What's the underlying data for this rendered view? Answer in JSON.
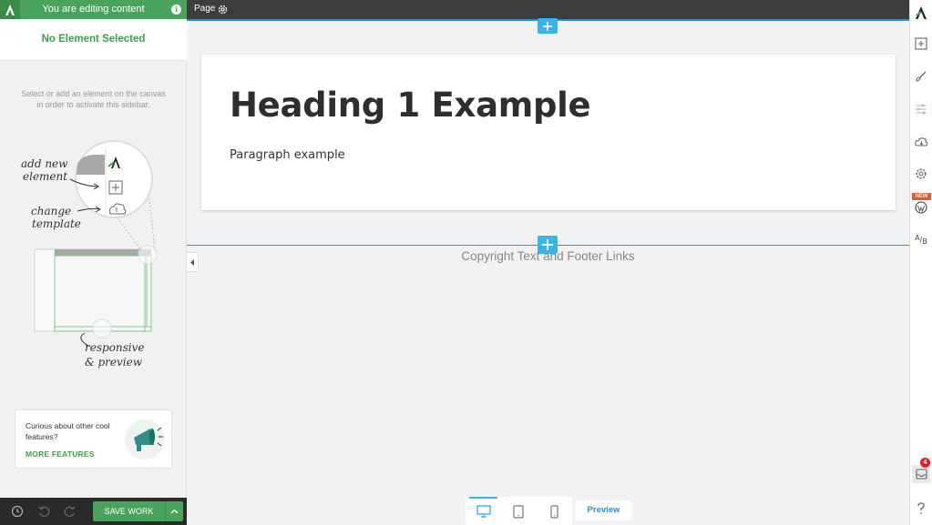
{
  "colors": {
    "green": "#4aa35a",
    "blue": "#39b3e8",
    "dark": "#3d3d3d",
    "new_badge": "#e8552a",
    "notif": "#d9232e"
  },
  "sidebar": {
    "banner_title": "You are editing content",
    "no_selection": "No Element Selected",
    "hint": "Select or add an element on the canvas in order to activate this sidebar.",
    "illustration": {
      "add_new_element": "add new element",
      "change_template": "change template",
      "responsive_preview": "responsive & preview"
    },
    "features_card": {
      "question": "Curious about other cool features?",
      "more_link": "MORE FEATURES"
    },
    "bottom": {
      "history_icon": "clock-icon",
      "undo_icon": "undo-icon",
      "redo_icon": "redo-icon",
      "save_label": "SAVE WORK"
    }
  },
  "topbar": {
    "page_label": "Page"
  },
  "canvas": {
    "heading": "Heading 1 Example",
    "paragraph": "Paragraph example",
    "footer_text": "Copyright Text and Footer Links"
  },
  "bottom_bar": {
    "devices": [
      "desktop-icon",
      "tablet-icon",
      "mobile-icon"
    ],
    "active_device": "desktop-icon",
    "preview_label": "Preview"
  },
  "right_toolbar": {
    "icons": [
      "logo",
      "add-element-icon",
      "brush-icon",
      "sliders-icon",
      "cloud-download-icon",
      "gear-icon",
      "wordpress-icon",
      "ab-test-icon"
    ],
    "new_badge": "NEW",
    "ab_label_a": "A",
    "ab_label_b": "B",
    "notification_count": "4"
  }
}
